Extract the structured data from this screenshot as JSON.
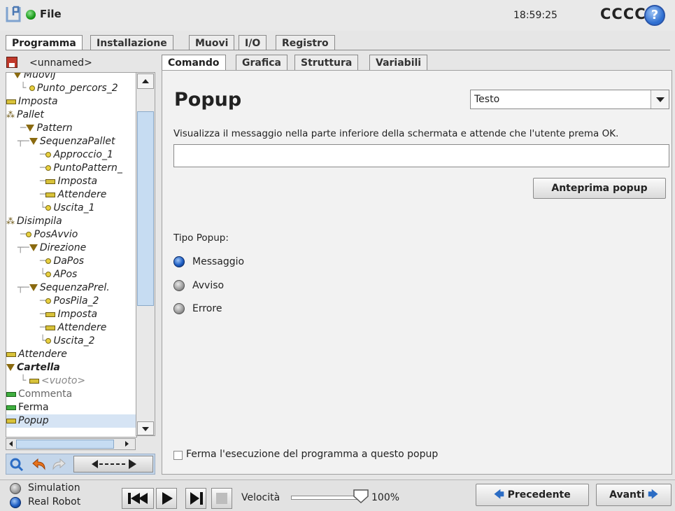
{
  "topbar": {
    "file_menu": "File",
    "clock": "18:59:25",
    "robot_name": "CCCC",
    "help": "?"
  },
  "main_tabs": [
    "Programma",
    "Installazione",
    "Muovi",
    "I/O",
    "Registro"
  ],
  "sub_tabs": [
    "Comando",
    "Grafica",
    "Struttura",
    "Variabili"
  ],
  "program_name": "<unnamed>",
  "tree": [
    {
      "label": "MuoviJ",
      "icon": "triangle"
    },
    {
      "label": "Punto_percors_2",
      "icon": "waypoint"
    },
    {
      "label": "Imposta",
      "icon": "bar"
    },
    {
      "label": "Pallet",
      "icon": "group"
    },
    {
      "label": "Pattern",
      "icon": "triangle"
    },
    {
      "label": "SequenzaPallet",
      "icon": "triangle"
    },
    {
      "label": "Approccio_1",
      "icon": "waypoint"
    },
    {
      "label": "PuntoPattern_",
      "icon": "waypoint"
    },
    {
      "label": "Imposta",
      "icon": "bar"
    },
    {
      "label": "Attendere",
      "icon": "bar"
    },
    {
      "label": "Uscita_1",
      "icon": "waypoint"
    },
    {
      "label": "Disimpila",
      "icon": "group"
    },
    {
      "label": "PosAvvio",
      "icon": "waypoint"
    },
    {
      "label": "Direzione",
      "icon": "triangle"
    },
    {
      "label": "DaPos",
      "icon": "waypoint"
    },
    {
      "label": "APos",
      "icon": "waypoint"
    },
    {
      "label": "SequenzaPrel.",
      "icon": "triangle"
    },
    {
      "label": "PosPila_2",
      "icon": "waypoint"
    },
    {
      "label": "Imposta",
      "icon": "bar"
    },
    {
      "label": "Attendere",
      "icon": "bar"
    },
    {
      "label": "Uscita_2",
      "icon": "waypoint"
    },
    {
      "label": "Attendere",
      "icon": "bar"
    },
    {
      "label": "Cartella",
      "icon": "triangle"
    },
    {
      "label": "<vuoto>",
      "icon": "bar"
    },
    {
      "label": "Commenta",
      "icon": "bar-green"
    },
    {
      "label": "Ferma",
      "icon": "bar-green"
    },
    {
      "label": "Popup",
      "icon": "bar"
    }
  ],
  "popup": {
    "title": "Popup",
    "type_select": "Testo",
    "description": "Visualizza il messaggio nella parte inferiore della schermata e attende che l'utente prema OK.",
    "message_value": "",
    "preview_button": "Anteprima popup",
    "popup_type_label": "Tipo Popup:",
    "options": [
      "Messaggio",
      "Avviso",
      "Errore"
    ],
    "selected_option": "Messaggio",
    "stop_checkbox_label": "Ferma l'esecuzione del programma a questo popup"
  },
  "footer": {
    "simulation": "Simulation",
    "real_robot": "Real Robot",
    "speed_label": "Velocità",
    "speed_value": "100%",
    "speed_fraction": 1.0,
    "prev_button": "Precedente",
    "next_button": "Avanti"
  }
}
